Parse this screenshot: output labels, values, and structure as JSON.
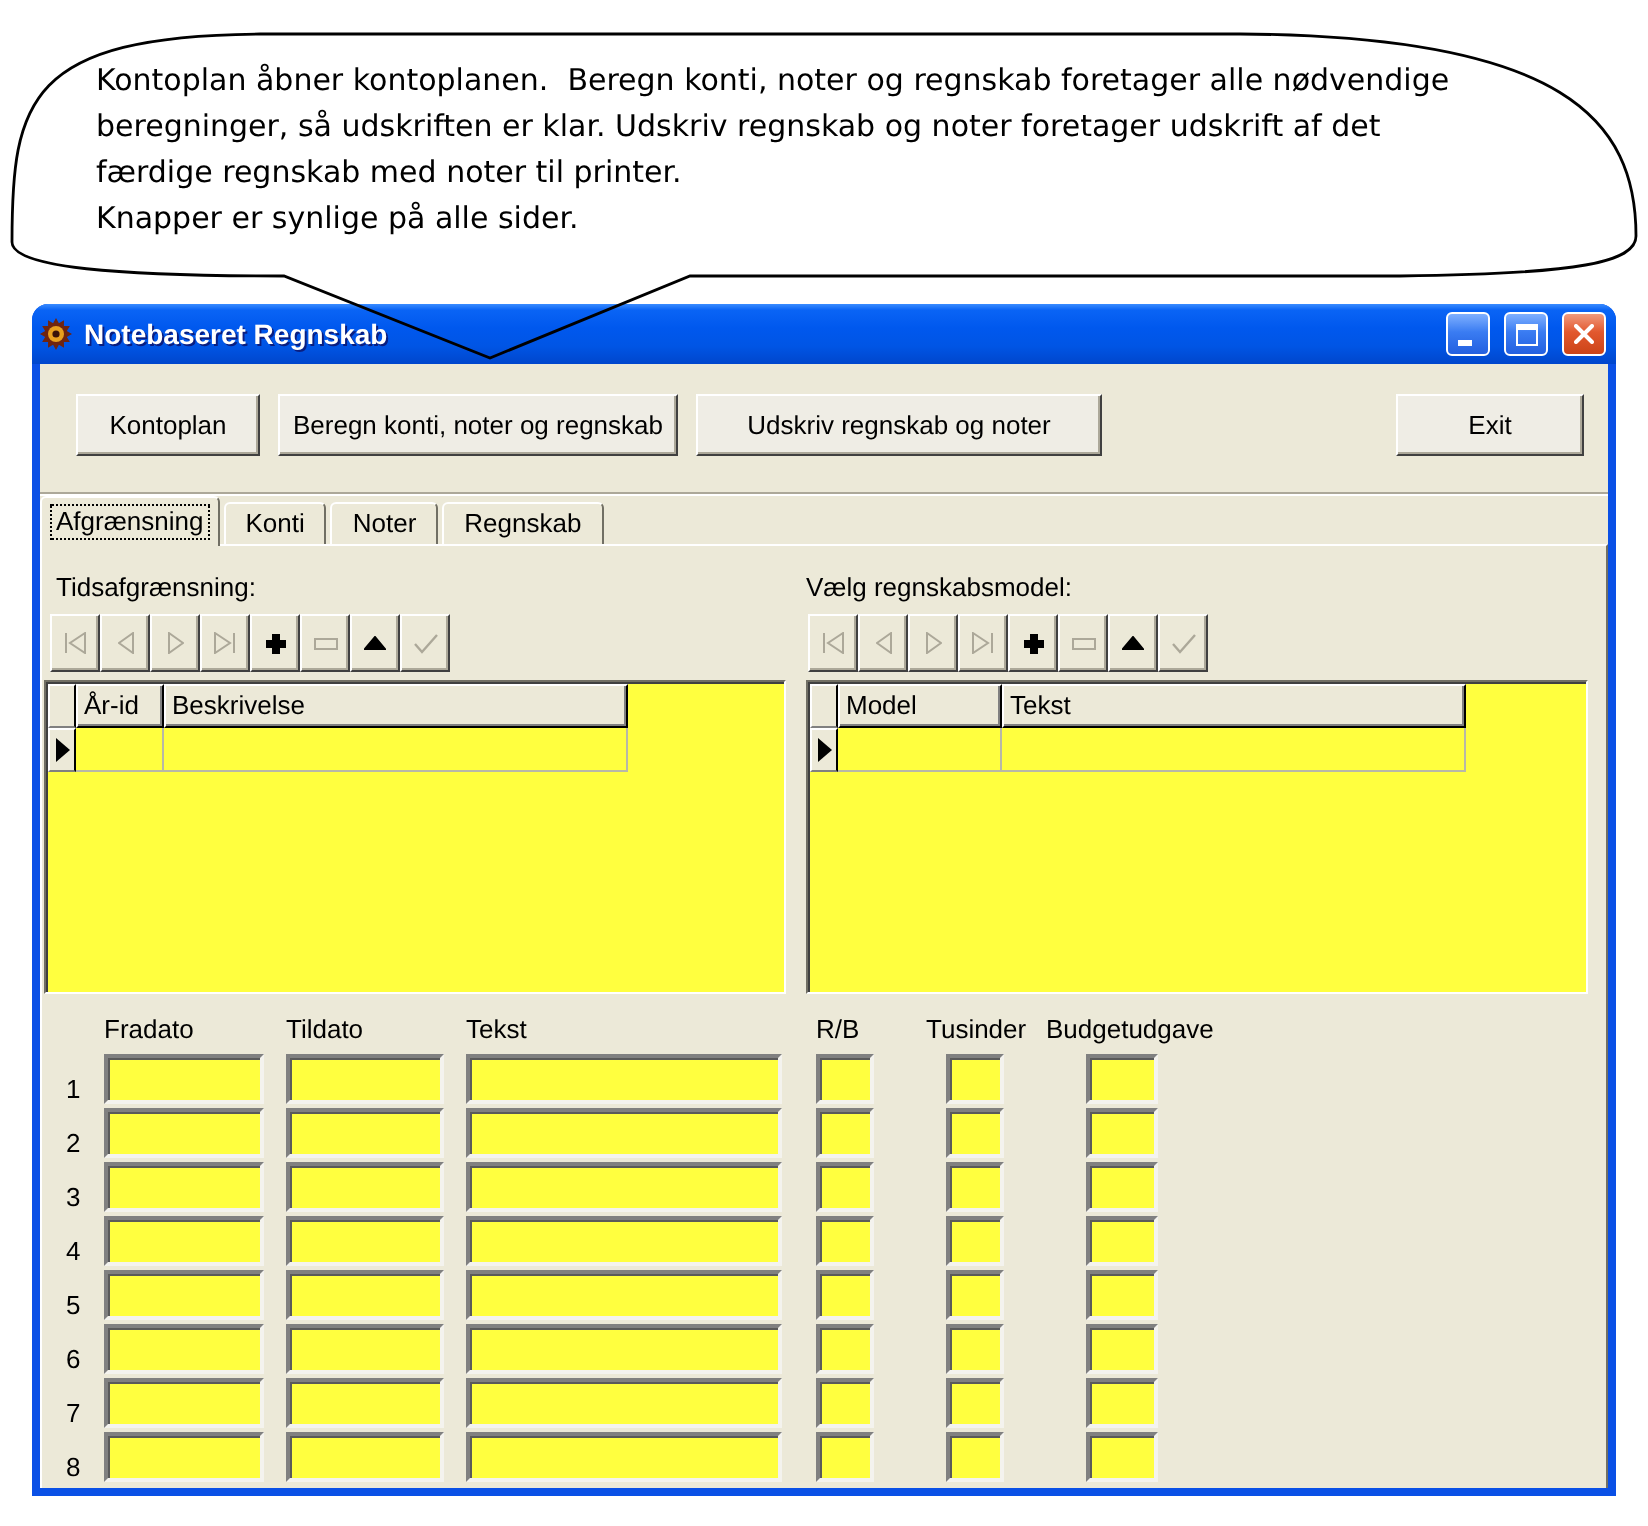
{
  "callout": {
    "paragraphs": [
      "Kontoplan åbner kontoplanen.  Beregn konti, noter og regnskab foretager alle nødvendige beregninger, så udskriften er klar. Udskriv regnskab og noter foretager udskrift af det færdige regnskab med noter til printer.",
      "Knapper er synlige på alle sider."
    ]
  },
  "window": {
    "title": "Notebaseret Regnskab"
  },
  "toolbar": {
    "buttons": [
      "Kontoplan",
      "Beregn konti, noter og regnskab",
      "Udskriv regnskab og noter",
      "Exit"
    ]
  },
  "tabs": [
    {
      "label": "Afgrænsning",
      "selected": true
    },
    {
      "label": "Konti",
      "selected": false
    },
    {
      "label": "Noter",
      "selected": false
    },
    {
      "label": "Regnskab",
      "selected": false
    }
  ],
  "panels": [
    {
      "label": "Tidsafgrænsning:",
      "navigator": [
        {
          "kind": "first",
          "disabled": true
        },
        {
          "kind": "prior",
          "disabled": true
        },
        {
          "kind": "next",
          "disabled": true
        },
        {
          "kind": "last",
          "disabled": true
        },
        {
          "kind": "insert",
          "disabled": false
        },
        {
          "kind": "delete",
          "disabled": true
        },
        {
          "kind": "edit",
          "disabled": false
        },
        {
          "kind": "post",
          "disabled": true
        }
      ],
      "grid": {
        "columns": [
          "År-id",
          "Beskrivelse"
        ],
        "rows": [
          {
            "selected": true
          }
        ]
      }
    },
    {
      "label": "Vælg regnskabsmodel:",
      "navigator": [
        {
          "kind": "first",
          "disabled": true
        },
        {
          "kind": "prior",
          "disabled": true
        },
        {
          "kind": "next",
          "disabled": true
        },
        {
          "kind": "last",
          "disabled": true
        },
        {
          "kind": "insert",
          "disabled": false
        },
        {
          "kind": "delete",
          "disabled": true
        },
        {
          "kind": "edit",
          "disabled": false
        },
        {
          "kind": "post",
          "disabled": true
        }
      ],
      "grid": {
        "columns": [
          "Model",
          "Tekst"
        ],
        "rows": [
          {
            "selected": true
          }
        ]
      }
    }
  ],
  "entry_table": {
    "columns": [
      "Fradato",
      "Tildato",
      "Tekst",
      "R/B",
      "Tusinder",
      "Budgetudgave"
    ],
    "rows": [
      {
        "number": "1"
      },
      {
        "number": "2"
      },
      {
        "number": "3"
      },
      {
        "number": "4"
      },
      {
        "number": "5"
      },
      {
        "number": "6"
      },
      {
        "number": "7"
      },
      {
        "number": "8"
      }
    ]
  }
}
